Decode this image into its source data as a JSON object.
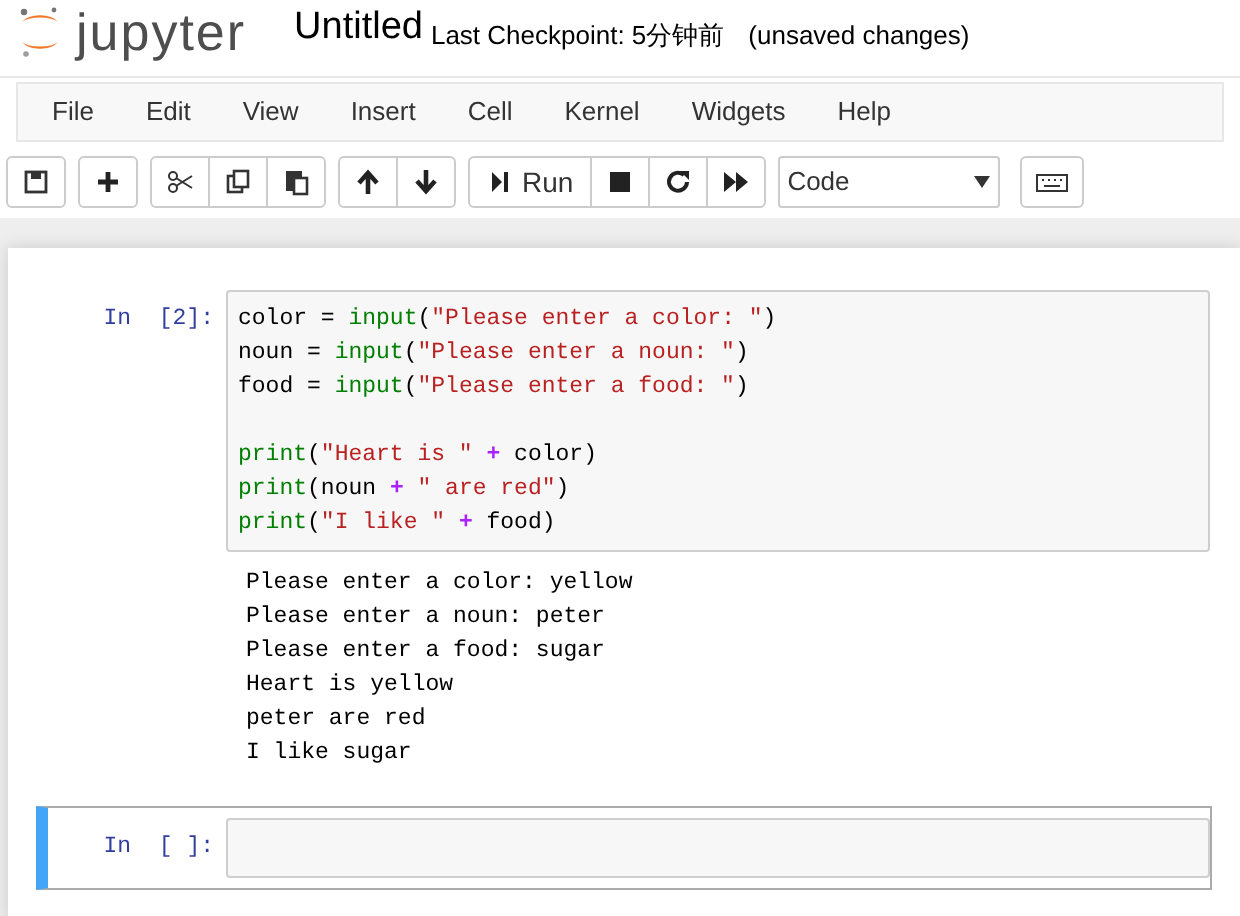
{
  "header": {
    "logo_text": "jupyter",
    "title": "Untitled",
    "checkpoint": "Last Checkpoint: 5分钟前",
    "status": "(unsaved changes)"
  },
  "menu": [
    "File",
    "Edit",
    "View",
    "Insert",
    "Cell",
    "Kernel",
    "Widgets",
    "Help"
  ],
  "toolbar": {
    "groups": [
      [
        {
          "kind": "save"
        }
      ],
      [
        {
          "kind": "add"
        }
      ],
      [
        {
          "kind": "cut"
        },
        {
          "kind": "copy"
        },
        {
          "kind": "paste"
        }
      ],
      [
        {
          "kind": "up"
        },
        {
          "kind": "down"
        }
      ],
      [
        {
          "kind": "run",
          "label": "Run"
        },
        {
          "kind": "stop"
        },
        {
          "kind": "restart"
        },
        {
          "kind": "fastforward"
        }
      ]
    ],
    "cell_type": "Code"
  },
  "cells": [
    {
      "prompt": "In  [2]:",
      "selected": false,
      "code_blocks": [
        [
          [
            {
              "kind": "name",
              "text": "color = "
            },
            {
              "kind": "builtin",
              "text": "input"
            },
            {
              "kind": "name",
              "text": "("
            },
            {
              "kind": "string",
              "text": "\"Please enter a color: \""
            },
            {
              "kind": "name",
              "text": ")"
            }
          ],
          [
            {
              "kind": "name",
              "text": "noun = "
            },
            {
              "kind": "builtin",
              "text": "input"
            },
            {
              "kind": "name",
              "text": "("
            },
            {
              "kind": "string",
              "text": "\"Please enter a noun: \""
            },
            {
              "kind": "name",
              "text": ")"
            }
          ],
          [
            {
              "kind": "name",
              "text": "food = "
            },
            {
              "kind": "builtin",
              "text": "input"
            },
            {
              "kind": "name",
              "text": "("
            },
            {
              "kind": "string",
              "text": "\"Please enter a food: \""
            },
            {
              "kind": "name",
              "text": ")"
            }
          ]
        ],
        [
          [
            {
              "kind": "builtin",
              "text": "print"
            },
            {
              "kind": "name",
              "text": "("
            },
            {
              "kind": "string",
              "text": "\"Heart is \" "
            },
            {
              "kind": "op",
              "text": "+"
            },
            {
              "kind": "name",
              "text": " color)"
            }
          ],
          [
            {
              "kind": "builtin",
              "text": "print"
            },
            {
              "kind": "name",
              "text": "(noun "
            },
            {
              "kind": "op",
              "text": "+"
            },
            {
              "kind": "string",
              "text": " \" are red\""
            },
            {
              "kind": "name",
              "text": ")"
            }
          ],
          [
            {
              "kind": "builtin",
              "text": "print"
            },
            {
              "kind": "name",
              "text": "("
            },
            {
              "kind": "string",
              "text": "\"I like \" "
            },
            {
              "kind": "op",
              "text": "+"
            },
            {
              "kind": "name",
              "text": " food)"
            }
          ]
        ]
      ],
      "output": [
        "Please enter a color: yellow",
        "Please enter a noun: peter",
        "Please enter a food: sugar",
        "Heart is yellow",
        "peter are red",
        "I like sugar"
      ]
    },
    {
      "prompt": "In  [ ]:",
      "selected": true
    }
  ]
}
